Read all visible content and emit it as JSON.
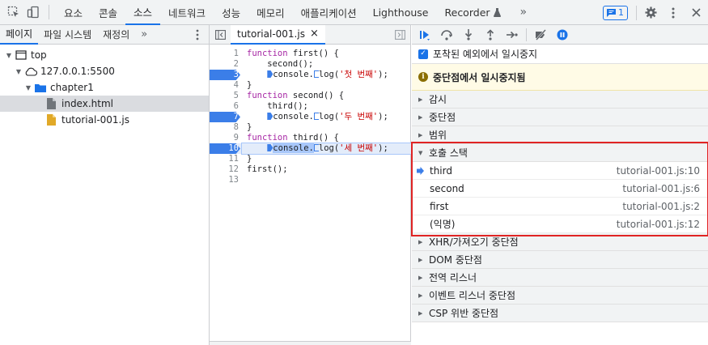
{
  "toolbar": {
    "tabs": [
      "요소",
      "콘솔",
      "소스",
      "네트워크",
      "성능",
      "메모리",
      "애플리케이션",
      "Lighthouse",
      "Recorder"
    ],
    "active_tab": "소스",
    "more_tabs": "»",
    "issues_count": "1",
    "colors": {
      "accent": "#1a73e8"
    }
  },
  "navigator": {
    "tabs": [
      "페이지",
      "파일 시스템",
      "재정의"
    ],
    "more": "»",
    "tree": {
      "top": "top",
      "host": "127.0.0.1:5500",
      "folder": "chapter1",
      "files": [
        "index.html",
        "tutorial-001.js"
      ]
    }
  },
  "editor": {
    "file_tab": "tutorial-001.js",
    "close": "×",
    "line_numbers": [
      "1",
      "2",
      "3",
      "4",
      "5",
      "6",
      "7",
      "8",
      "9",
      "10",
      "11",
      "12",
      "13"
    ],
    "code": {
      "l1": "function first() {",
      "l2": "    second();",
      "l3_pre": "    ",
      "l3_a": "console.",
      "l3_b": "log(",
      "l3_str": "'첫 번째'",
      "l3_end": ");",
      "l4": "}",
      "l5": "function second() {",
      "l6": "    third();",
      "l7_pre": "    ",
      "l7_a": "console.",
      "l7_b": "log(",
      "l7_str": "'두 번째'",
      "l7_end": ");",
      "l8": "}",
      "l9": "function third() {",
      "l10_pre": "    ",
      "l10_a": "console.",
      "l10_b": "log(",
      "l10_str": "'세 번째'",
      "l10_end": ");",
      "l11": "}",
      "l12": "first();",
      "l13": ""
    },
    "keywords": {
      "function": "function"
    },
    "breakpoint_lines": [
      "3",
      "7",
      "10"
    ],
    "paused_line": "10"
  },
  "debugger": {
    "pause_on_caught": "포착된 예외에서 일시중지",
    "paused_banner": "중단점에서 일시중지됨",
    "sections_top": [
      "감시",
      "중단점",
      "범위"
    ],
    "callstack_title": "호출 스택",
    "callstack": [
      {
        "name": "third",
        "location": "tutorial-001.js:10"
      },
      {
        "name": "second",
        "location": "tutorial-001.js:6"
      },
      {
        "name": "first",
        "location": "tutorial-001.js:2"
      },
      {
        "name": "(익명)",
        "location": "tutorial-001.js:12"
      }
    ],
    "sections_bottom": [
      "XHR/가져오기 중단점",
      "DOM 중단점",
      "전역 리스너",
      "이벤트 리스너 중단점",
      "CSP 위반 중단점"
    ],
    "colors": {
      "highlight_box": "#e02424",
      "banner_bg": "#fffbe6"
    }
  }
}
